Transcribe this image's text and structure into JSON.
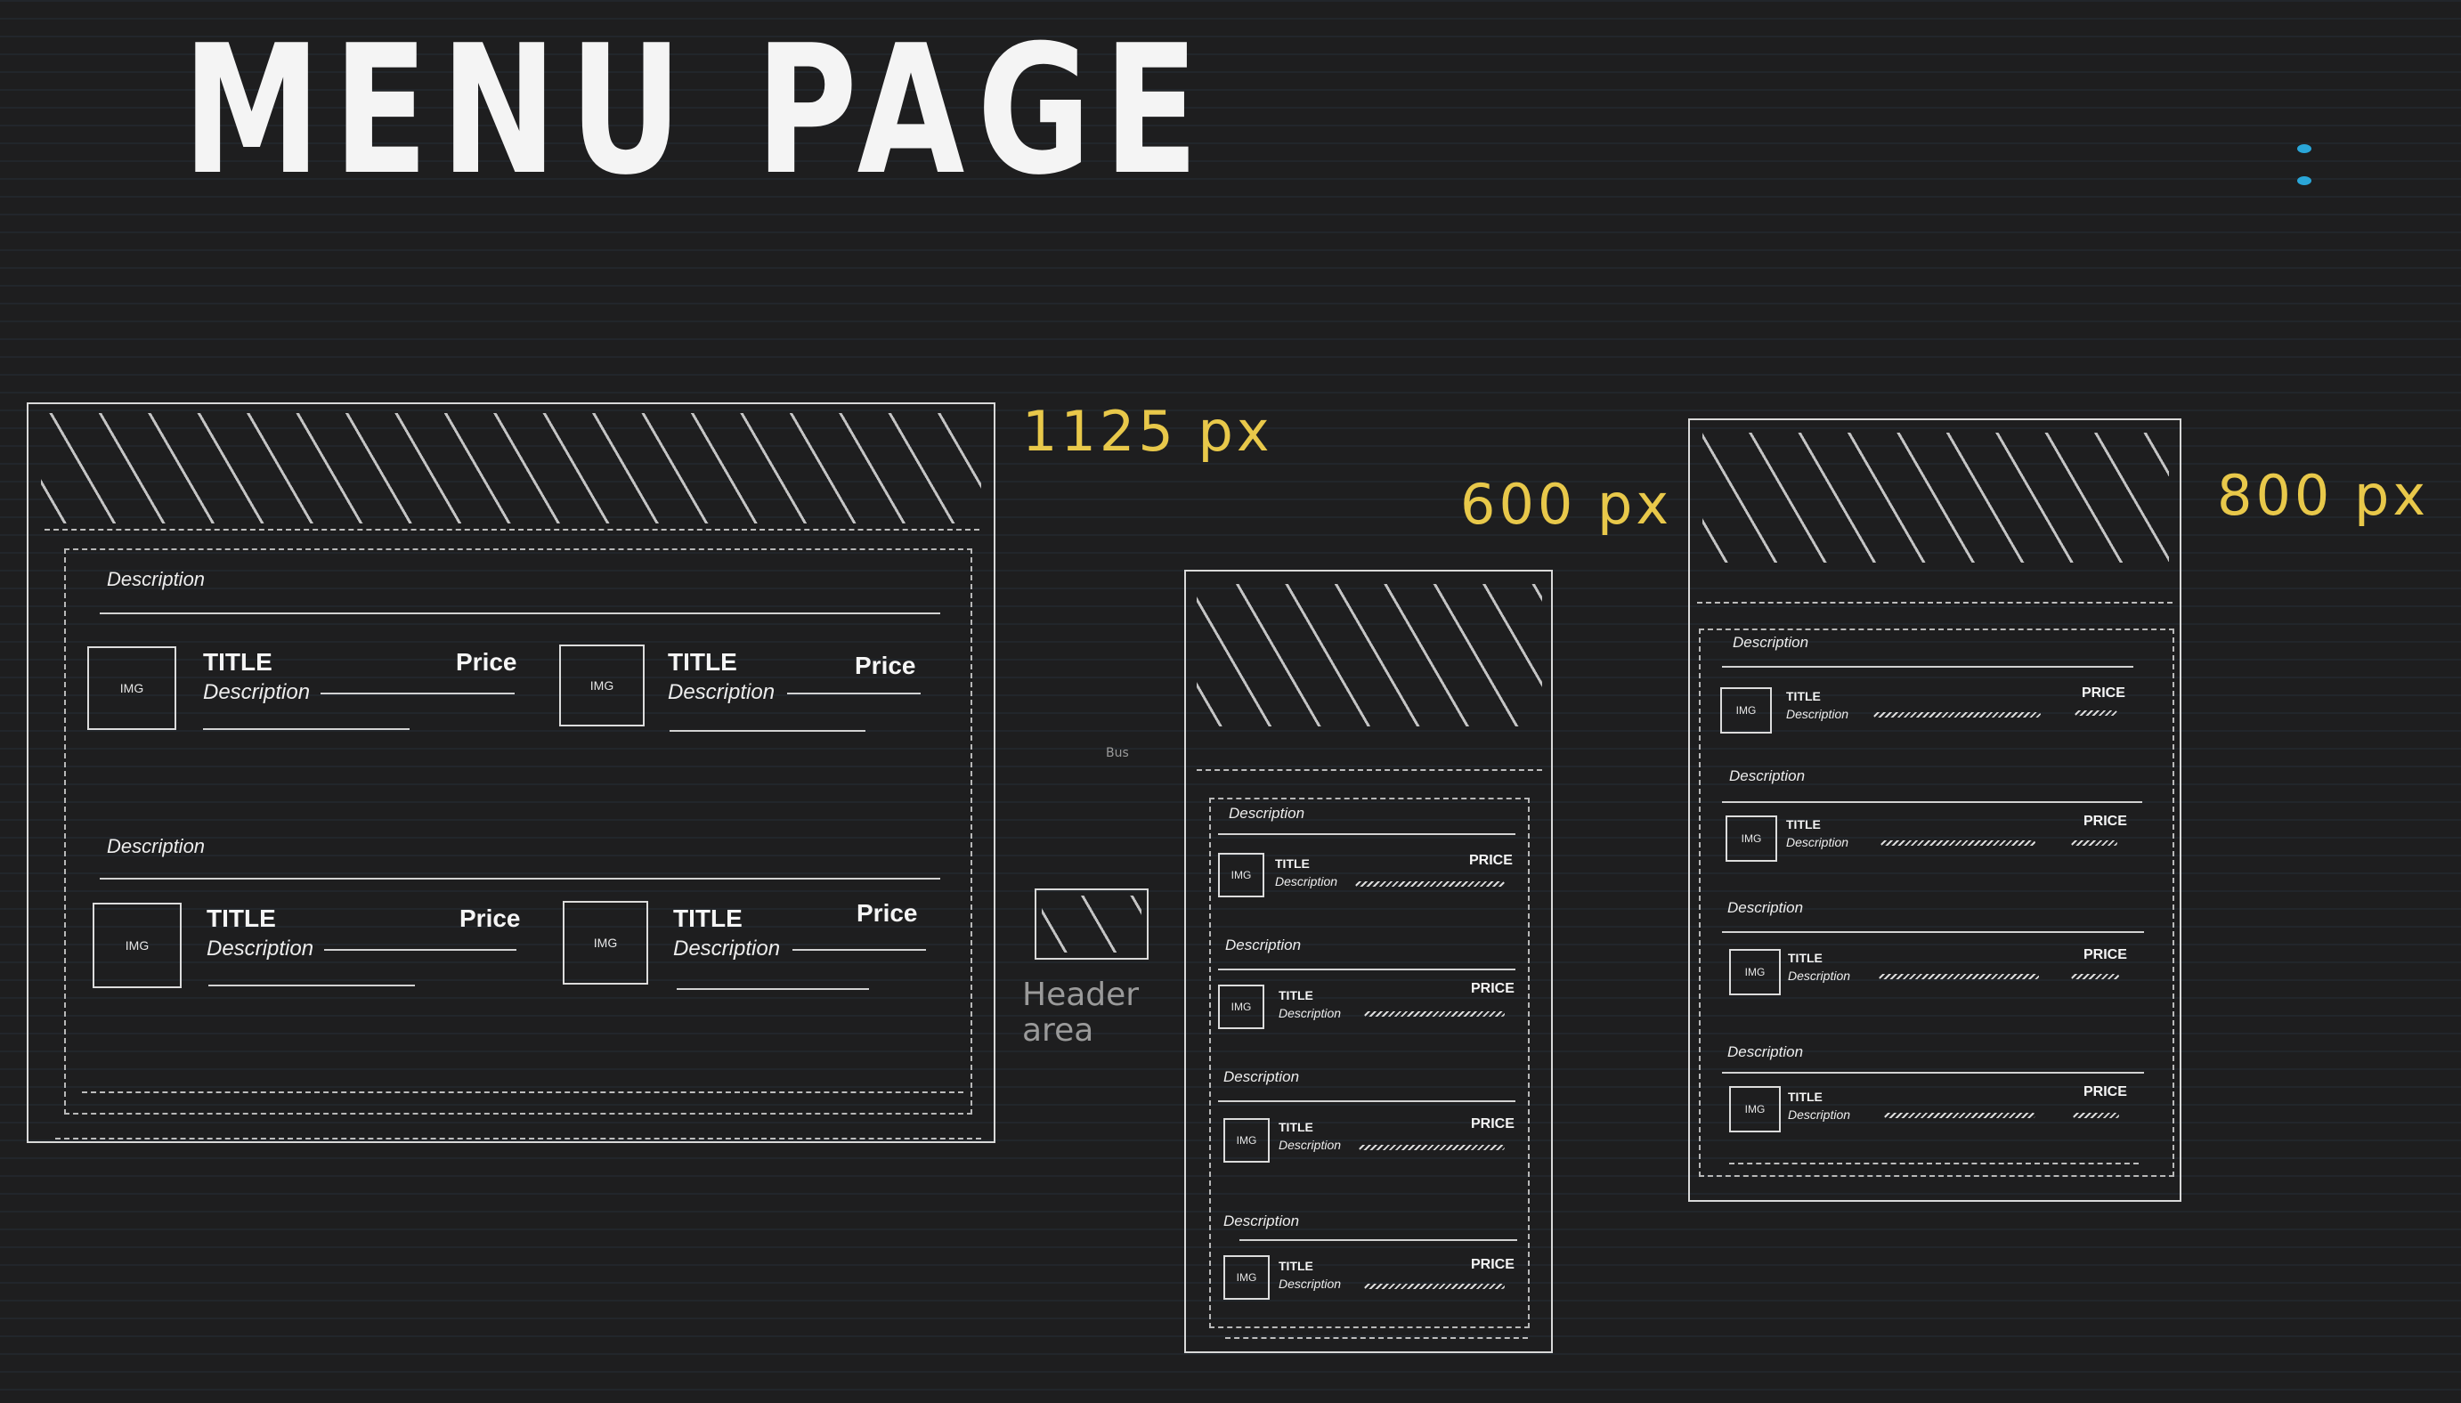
{
  "page": {
    "title": "MENU PAGE"
  },
  "labels": {
    "w1125": "1125 px",
    "w600": "600 px",
    "w800": "800 px",
    "bus": "Bus",
    "header_area": "Header area"
  },
  "item_img": "IMG",
  "wide": {
    "sections": [
      {
        "description": "Description",
        "items": [
          {
            "title": "TITLE",
            "description": "Description",
            "price": "Price"
          },
          {
            "title": "TITLE",
            "description": "Description",
            "price": "Price"
          }
        ]
      },
      {
        "description": "Description",
        "items": [
          {
            "title": "TITLE",
            "description": "Description",
            "price": "Price"
          },
          {
            "title": "TITLE",
            "description": "Description",
            "price": "Price"
          }
        ]
      }
    ]
  },
  "medium": {
    "sections": [
      {
        "description": "Description",
        "item": {
          "title": "TITLE",
          "description": "Description",
          "price": "PRICE"
        }
      },
      {
        "description": "Description",
        "item": {
          "title": "TITLE",
          "description": "Description",
          "price": "PRICE"
        }
      },
      {
        "description": "Description",
        "item": {
          "title": "TITLE",
          "description": "Description",
          "price": "PRICE"
        }
      },
      {
        "description": "Description",
        "item": {
          "title": "TITLE",
          "description": "Description",
          "price": "PRICE"
        }
      }
    ]
  },
  "narrow": {
    "sections": [
      {
        "description": "Description",
        "item": {
          "title": "TITLE",
          "description": "Description",
          "price": "PRICE"
        }
      },
      {
        "description": "Description",
        "item": {
          "title": "TITLE",
          "description": "Description",
          "price": "PRICE"
        }
      },
      {
        "description": "Description",
        "item": {
          "title": "TITLE",
          "description": "Description",
          "price": "PRICE"
        }
      },
      {
        "description": "Description",
        "item": {
          "title": "TITLE",
          "description": "Description",
          "price": "PRICE"
        }
      }
    ]
  },
  "colors": {
    "background": "#1e1e1f",
    "sketch_line": "#d9d9d9",
    "dimension_label": "#e8c84a",
    "accent_dot": "#2aa6d8"
  }
}
